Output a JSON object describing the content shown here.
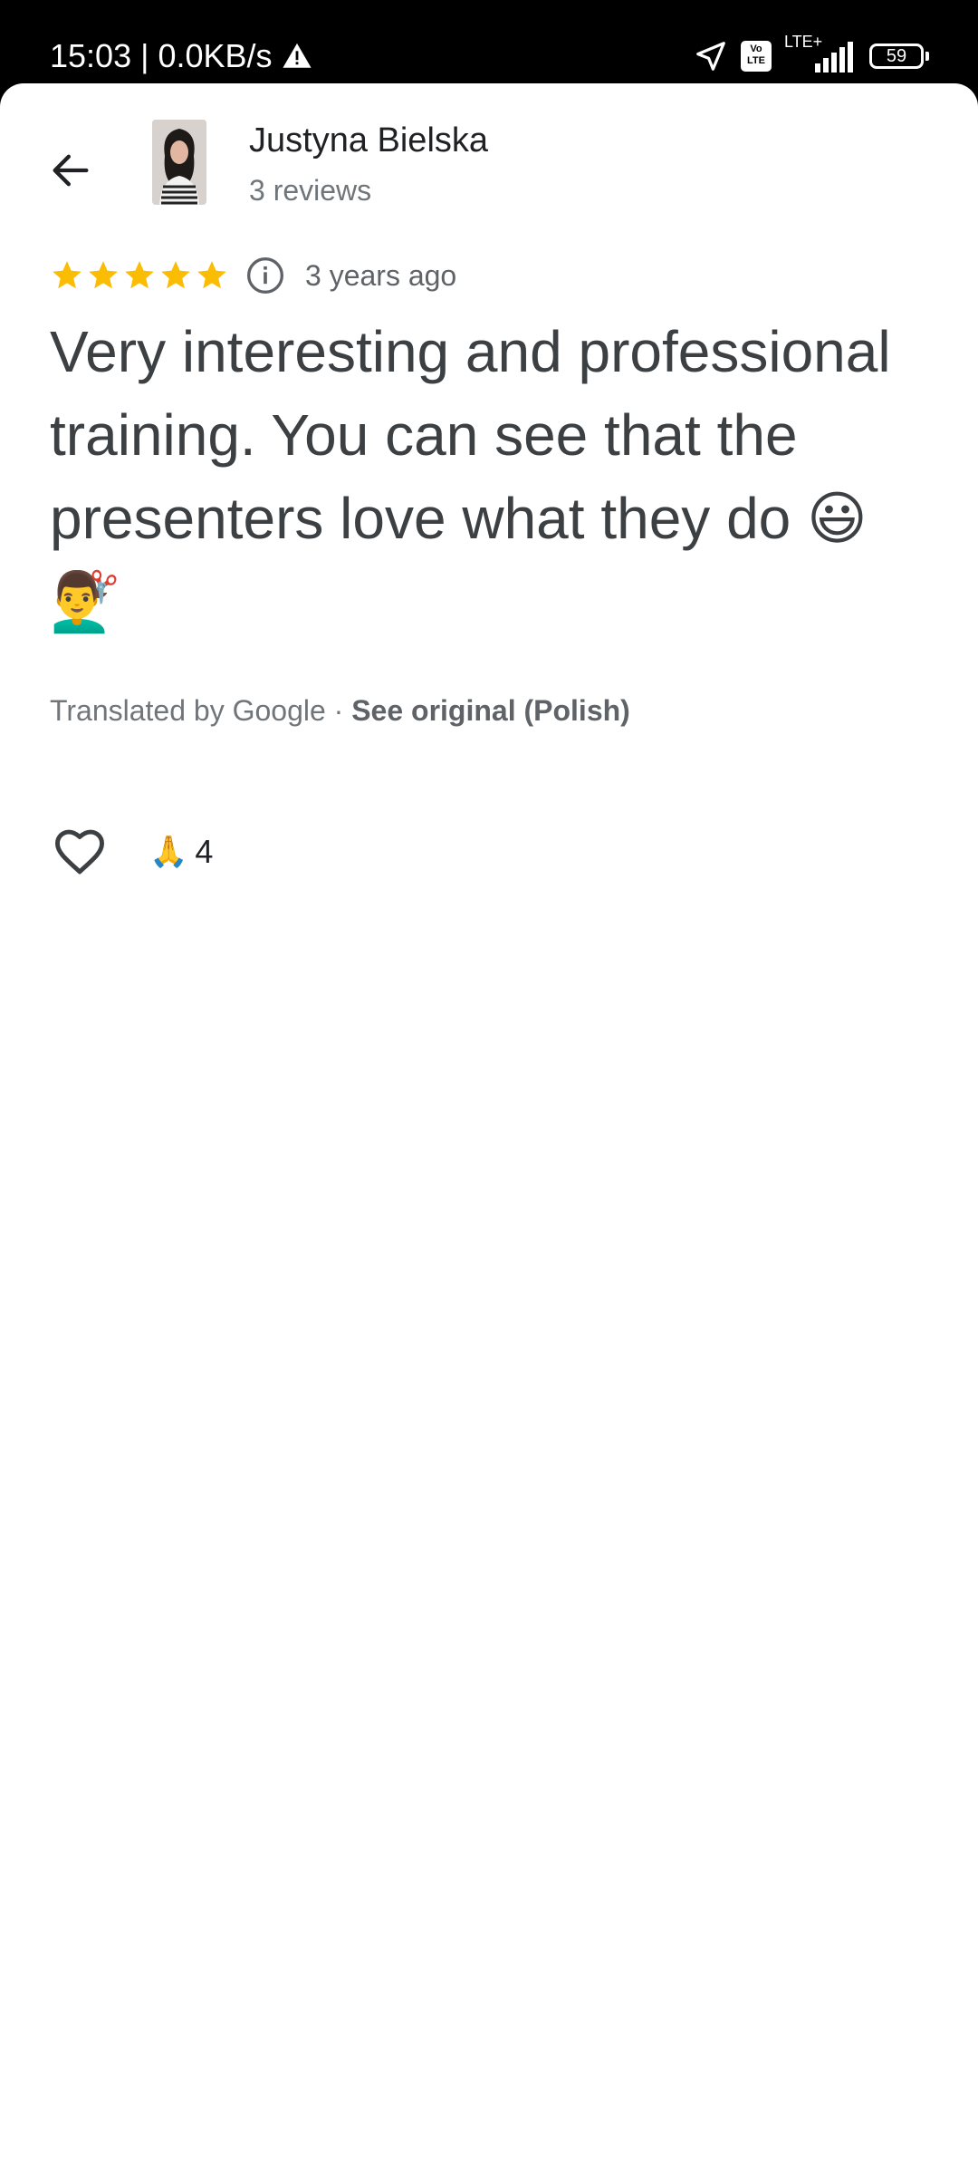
{
  "status_bar": {
    "time_speed": "15:03 | 0.0KB/s",
    "volte_label": "Vo LTE",
    "network_label": "LTE+",
    "battery_level": "59"
  },
  "reviewer": {
    "name": "Justyna Bielska",
    "review_count": "3 reviews"
  },
  "review": {
    "rating": 5,
    "age": "3 years ago",
    "text": "Very interesting and professional training. You can see that the presenters love what they do 😃💇‍♂️",
    "translation_prefix": "Translated by Google · ",
    "see_original_label": "See original (Polish)"
  },
  "reactions": {
    "emoji": "🙏",
    "count": "4"
  },
  "icons": {
    "back": "arrow-back-icon",
    "info": "info-icon",
    "like": "heart-outline-icon",
    "star": "star-icon",
    "navigation": "location-arrow-icon",
    "warning": "warning-icon"
  },
  "colors": {
    "star": "#FBBC04",
    "text_primary": "#202124",
    "text_secondary": "#70757a",
    "review_text": "#3c4043"
  }
}
